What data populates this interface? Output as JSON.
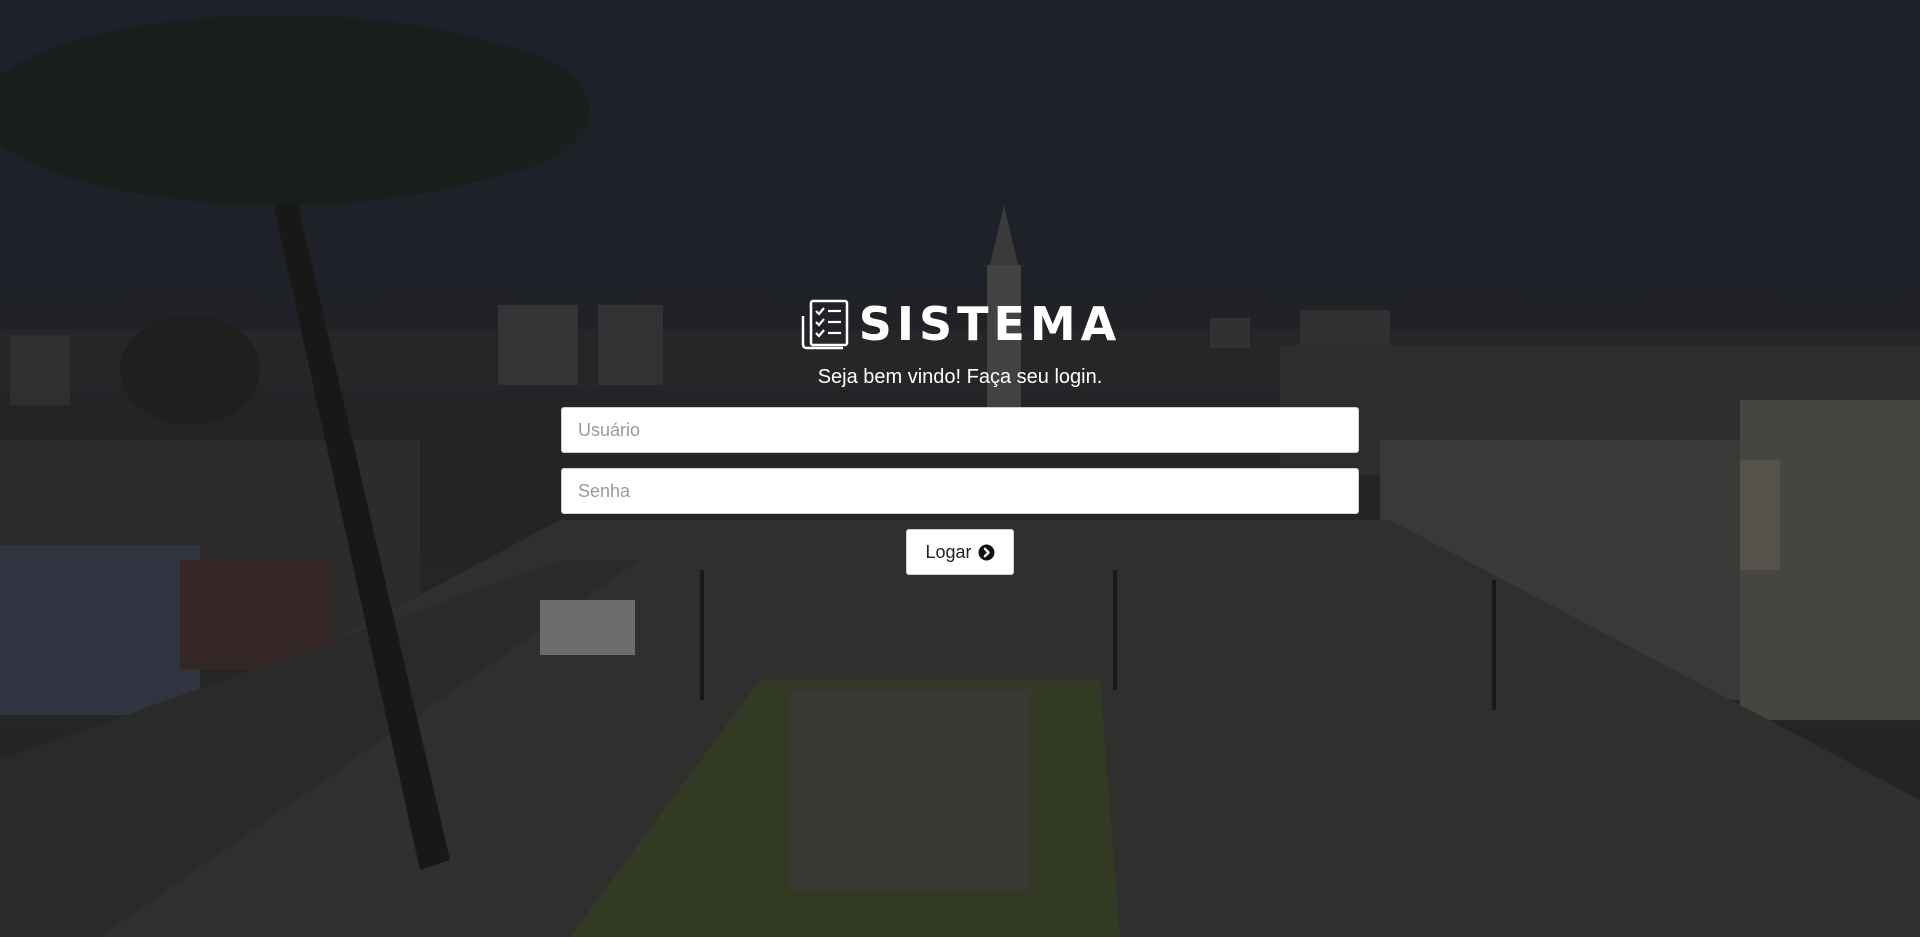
{
  "brand": {
    "name": "SISTEMA",
    "icon": "checklist-document-icon"
  },
  "login": {
    "welcome": "Seja bem vindo! Faça seu login.",
    "username_placeholder": "Usuário",
    "username_value": "",
    "password_placeholder": "Senha",
    "password_value": "",
    "submit_label": "Logar",
    "submit_icon": "arrow-circle-right-icon"
  },
  "colors": {
    "text": "#ffffff",
    "input_bg": "#ffffff",
    "button_bg": "#ffffff"
  }
}
